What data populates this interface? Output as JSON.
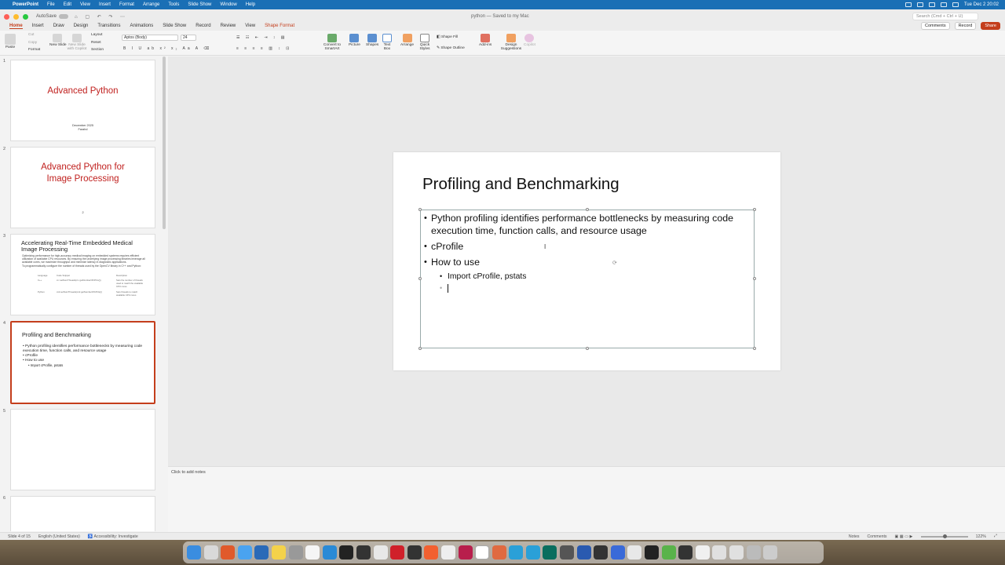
{
  "menubar": {
    "app": "PowerPoint",
    "items": [
      "File",
      "Edit",
      "View",
      "Insert",
      "Format",
      "Arrange",
      "Tools",
      "Slide Show",
      "Window",
      "Help"
    ],
    "datetime": "Tue Dec 2  20:02"
  },
  "titlebar": {
    "autosave": "AutoSave",
    "doc_title": "python — Saved to my Mac",
    "search_placeholder": "Search (Cmd + Ctrl + U)"
  },
  "tabs": {
    "items": [
      "Home",
      "Insert",
      "Draw",
      "Design",
      "Transitions",
      "Animations",
      "Slide Show",
      "Record",
      "Review",
      "View"
    ],
    "active": "Home",
    "contextual": "Shape Format",
    "comments": "Comments",
    "record": "Record",
    "share": "Share"
  },
  "ribbon": {
    "paste": "Paste",
    "cut": "Cut",
    "copy": "Copy",
    "format": "Format",
    "new_slide": "New Slide",
    "new_slide_copilot": "New Slide with Copilot",
    "layout": "Layout",
    "reset": "Reset",
    "section": "Section",
    "font_name": "Aptos (Body)",
    "font_size": "24",
    "convert_smartart": "Convert to SmartArt",
    "picture": "Picture",
    "shapes": "Shapes",
    "text_box": "Text Box",
    "arrange": "Arrange",
    "quick_styles": "Quick Styles",
    "shape_fill": "Shape Fill",
    "shape_outline": "Shape Outline",
    "add_ins": "Add-ins",
    "design_suggestions": "Design Suggestions",
    "copilot": "Copilot"
  },
  "thumbnails": {
    "s1": {
      "num": "1",
      "title": "Advanced Python",
      "date": "December 2025",
      "author": "Farahd"
    },
    "s2": {
      "num": "2",
      "title": "Advanced Python for Image Processing",
      "page": "2"
    },
    "s3": {
      "num": "3",
      "title": "Accelerating Real-Time Embedded Medical Image Processing",
      "b1": "Optimizing performance for high-accuracy medical imaging on embedded systems requires efficient utilization of available CPU resources. By ensuring the underlying image processing libraries leverage all available cores, we maximize throughput and minimize latency in diagnostic applications.",
      "b2": "To programmatically configure the number of threads used by the OpenCV library in C++ and Python:",
      "col1": "Language",
      "col2": "Code Snippet",
      "col3": "Description",
      "r1c1": "C++",
      "r1c2": "cv::setNumThreads(cv::getNumberOfCPUs());",
      "r1c3": "Sets the number of threads used to match the available CPU cores",
      "r2c1": "Python",
      "r2c2": "cv2.setNumThreads(cv2.getNumberOfCPUs())",
      "r2c3": "Sets threads to match available CPU cores"
    },
    "s4": {
      "num": "4",
      "title": "Profiling and Benchmarking",
      "b1": "Python profiling identifies performance bottlenecks by measuring code execution time, function calls, and resource usage",
      "b2": "cProfile",
      "b3": "How to use",
      "b4": "Import cProfile, pstats"
    },
    "s5": {
      "num": "5"
    },
    "s6": {
      "num": "6"
    }
  },
  "slide": {
    "title": "Profiling and Benchmarking",
    "bullet1": "Python profiling identifies performance bottlenecks by measuring code execution time, function calls, and resource usage",
    "bullet2": "cProfile",
    "bullet3": "How to use",
    "sub1": "Import cProfile, pstats"
  },
  "notes": {
    "placeholder": "Click to add notes"
  },
  "status": {
    "slide": "Slide 4 of 15",
    "language": "English (United States)",
    "accessibility": "Accessibility: Investigate",
    "notes": "Notes",
    "comments": "Comments",
    "zoom": "122%"
  }
}
